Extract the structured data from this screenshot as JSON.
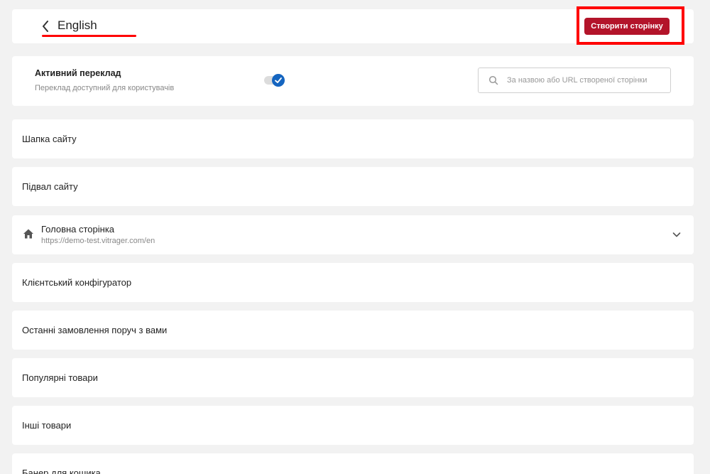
{
  "header": {
    "title": "English",
    "create_button_label": "Створити сторінку"
  },
  "translation": {
    "title": "Активний переклад",
    "subtitle": "Переклад доступний для користувачів",
    "active": true
  },
  "search": {
    "placeholder": "За назвою або URL створеної сторінки",
    "value": ""
  },
  "rows": [
    {
      "label": "Шапка сайту"
    },
    {
      "label": "Підвал сайту"
    },
    {
      "label": "Головна сторінка",
      "url": "https://demo-test.vitrager.com/en"
    },
    {
      "label": "Клієнтський конфігуратор"
    },
    {
      "label": "Останні замовлення поруч з вами"
    },
    {
      "label": "Популярні товари"
    },
    {
      "label": "Інші товари"
    },
    {
      "label": "Банер для кошика"
    }
  ],
  "colors": {
    "accent": "#b3142a",
    "toggle_on": "#1565c0",
    "highlight": "#ff0000"
  }
}
